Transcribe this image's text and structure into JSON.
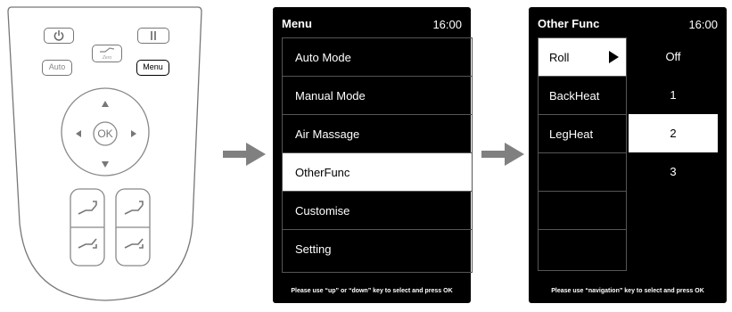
{
  "remote": {
    "auto_label": "Auto",
    "menu_label": "Menu",
    "ok_label": "OK",
    "zero_g_label": "Zero"
  },
  "menu_screen": {
    "title": "Menu",
    "time": "16:00",
    "items": [
      "Auto Mode",
      "Manual Mode",
      "Air Massage",
      "OtherFunc",
      "Customise",
      "Setting"
    ],
    "selected_index": 3,
    "hint": "Please use “up” or “down” key to select and press OK"
  },
  "other_screen": {
    "title": "Other Func",
    "time": "16:00",
    "functions": [
      "Roll",
      "BackHeat",
      "LegHeat",
      "",
      "",
      ""
    ],
    "selected_function_index": 0,
    "values": [
      "Off",
      "1",
      "2",
      "3"
    ],
    "selected_value_index": 2,
    "hint": "Please use “navigation” key to select and press OK"
  },
  "colors": {
    "screen_bg": "#000000",
    "selected_bg": "#ffffff",
    "arrow": "#808080",
    "remote_outline": "#777777"
  }
}
